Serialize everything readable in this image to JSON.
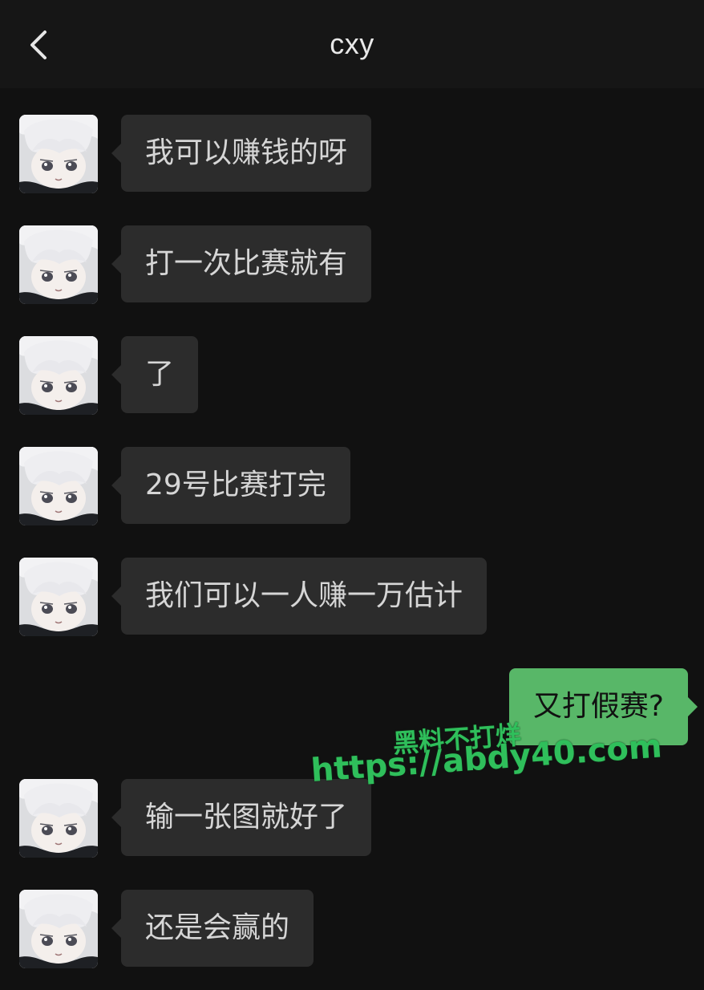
{
  "header": {
    "title": "cxy",
    "back_icon": "chevron-left-icon"
  },
  "colors": {
    "background": "#111111",
    "incoming_bubble": "#2c2c2c",
    "outgoing_bubble": "#58b768",
    "watermark": "#2fbf5b"
  },
  "messages": [
    {
      "side": "in",
      "text": "我可以赚钱的呀"
    },
    {
      "side": "in",
      "text": "打一次比赛就有"
    },
    {
      "side": "in",
      "text": "了"
    },
    {
      "side": "in",
      "text": "29号比赛打完"
    },
    {
      "side": "in",
      "text": "我们可以一人赚一万估计"
    },
    {
      "side": "out",
      "text": "又打假赛?"
    },
    {
      "side": "in",
      "text": "输一张图就好了"
    },
    {
      "side": "in",
      "text": "还是会赢的"
    }
  ],
  "watermark": {
    "line1": "黑料不打烊",
    "line2": "https://abdy40.com"
  }
}
